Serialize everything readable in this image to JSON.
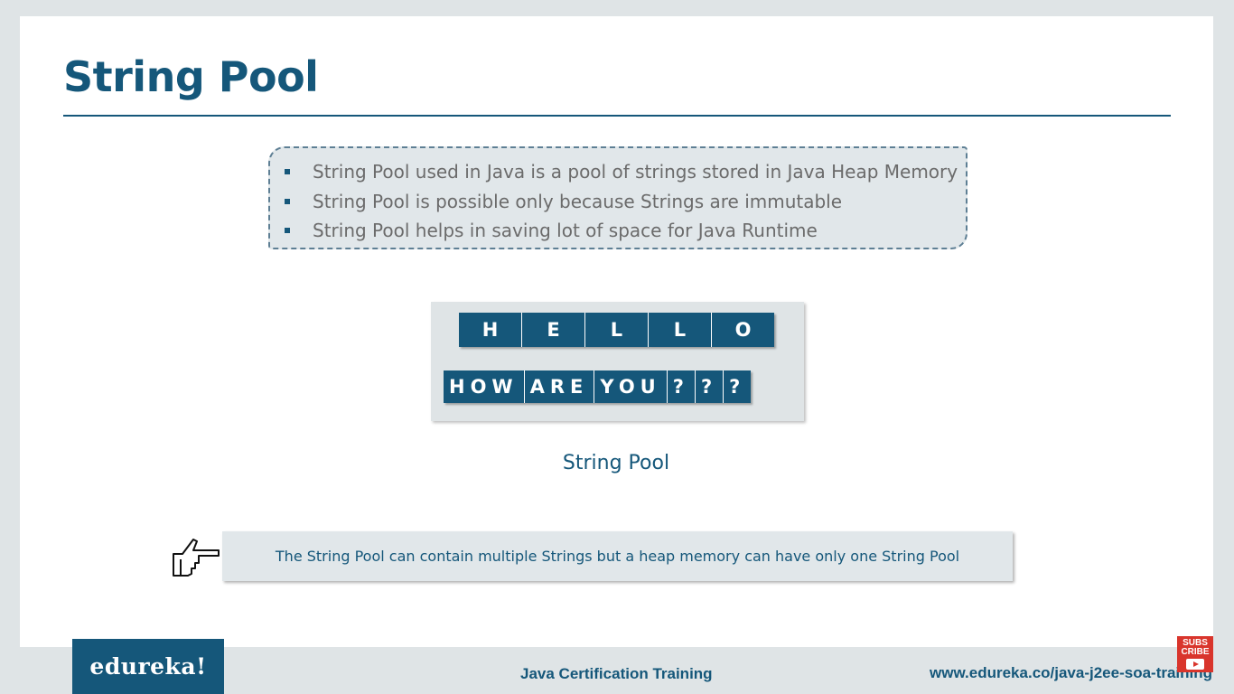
{
  "slide": {
    "title": "String Pool",
    "bullets": [
      "String Pool used in Java is a pool of strings stored in Java Heap Memory",
      "String Pool is possible only because Strings are immutable",
      "String Pool helps in saving lot of space for Java Runtime"
    ],
    "figure": {
      "row1": [
        "H",
        "E",
        "L",
        "L",
        "O"
      ],
      "row2": [
        "HOW",
        "ARE",
        "YOU",
        "?",
        "?",
        "?"
      ],
      "caption": "String Pool"
    },
    "note": "The String Pool can contain multiple Strings but a heap memory can have only one String Pool"
  },
  "footer": {
    "logo": "edureka!",
    "course": "Java Certification Training",
    "url": "www.edureka.co/java-j2ee-soa-training",
    "subscribe": [
      "SUBS",
      "CRIBE"
    ]
  },
  "colors": {
    "primary": "#15577a",
    "panel": "#e1e7ea",
    "background": "#dfe4e6",
    "subscribe_red": "#d9352c"
  },
  "icons": {
    "note": "pointing-hand-icon"
  }
}
